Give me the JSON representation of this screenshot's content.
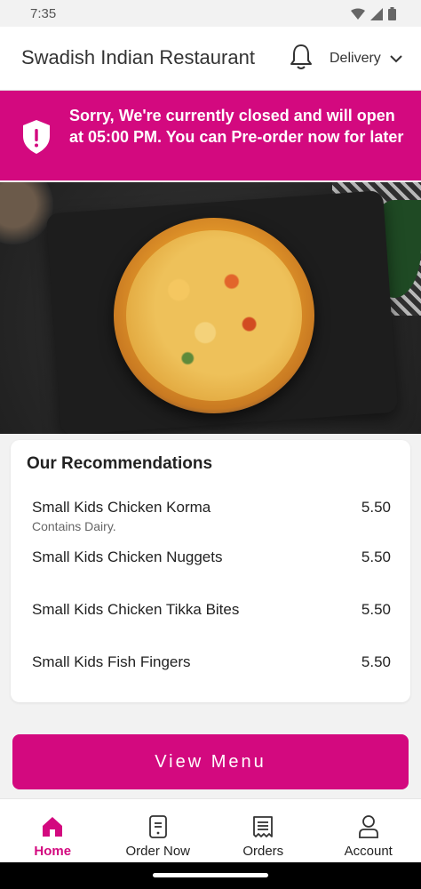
{
  "status": {
    "time": "7:35"
  },
  "header": {
    "restaurant_name": "Swadish Indian Restaurant",
    "delivery_label": "Delivery"
  },
  "banner": {
    "message": "Sorry, We're currently closed and will open at 05:00 PM. You can Pre-order now for later"
  },
  "recommendations": {
    "title": "Our Recommendations",
    "items": [
      {
        "name": "Small Kids Chicken Korma",
        "price": "5.50",
        "note": "Contains Dairy."
      },
      {
        "name": "Small Kids Chicken Nuggets",
        "price": "5.50"
      },
      {
        "name": "Small Kids Chicken Tikka Bites",
        "price": "5.50"
      },
      {
        "name": "Small Kids Fish Fingers",
        "price": "5.50"
      }
    ]
  },
  "cta": {
    "view_menu": "View Menu"
  },
  "nav": {
    "items": [
      {
        "label": "Home",
        "icon": "home-icon",
        "active": true
      },
      {
        "label": "Order Now",
        "icon": "order-icon"
      },
      {
        "label": "Orders",
        "icon": "receipt-icon"
      },
      {
        "label": "Account",
        "icon": "account-icon"
      }
    ]
  },
  "colors": {
    "brand": "#d3097f"
  }
}
